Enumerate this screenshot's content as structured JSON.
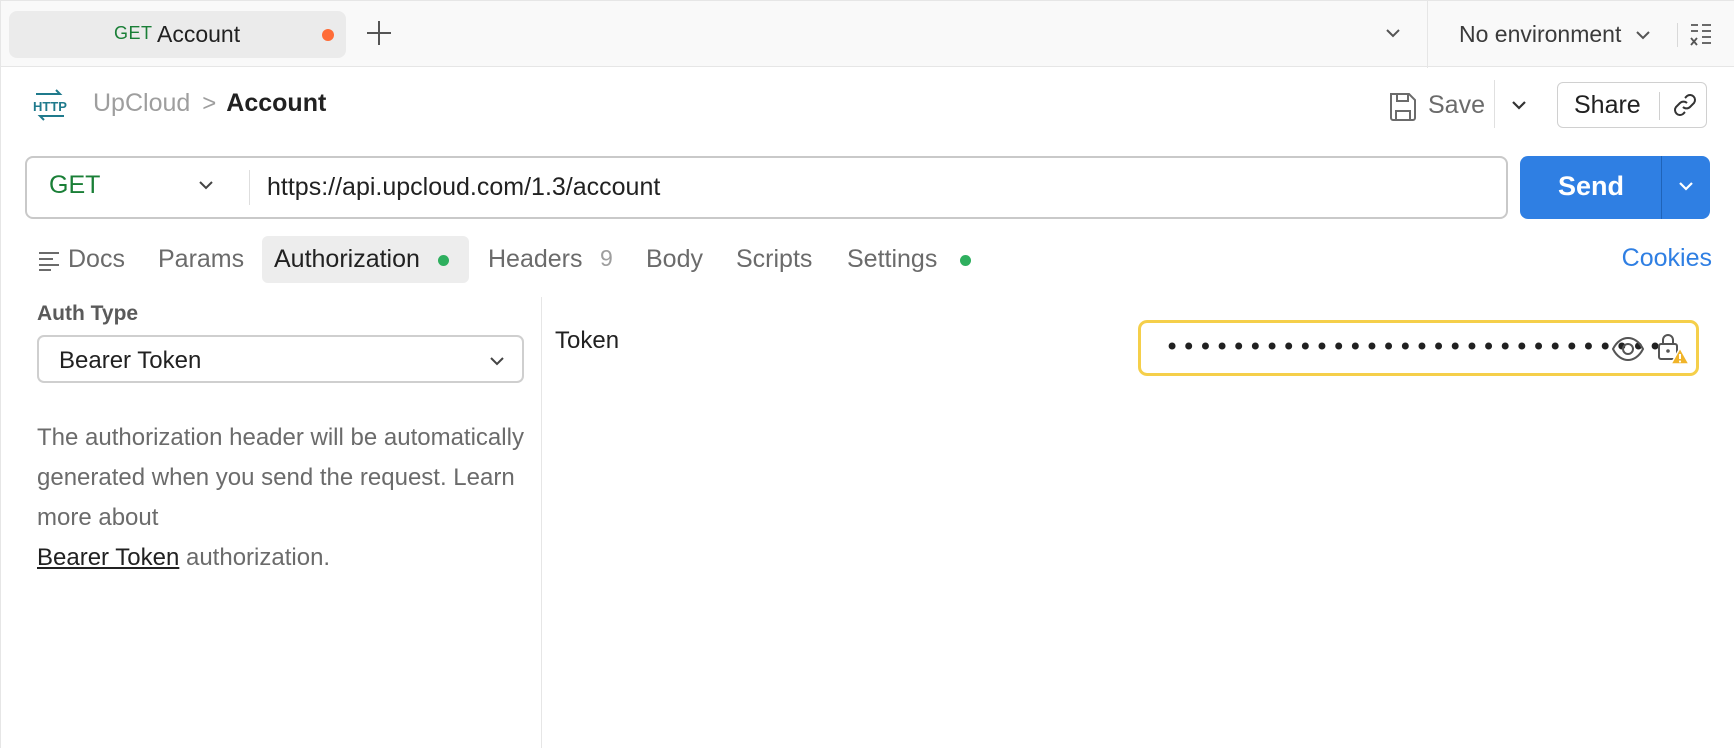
{
  "tab": {
    "method": "GET",
    "name": "Account",
    "unsaved_color": "#ff6c37"
  },
  "environment": {
    "selected": "No environment"
  },
  "header": {
    "breadcrumb_parent": "UpCloud",
    "breadcrumb_separator": ">",
    "breadcrumb_current": "Account",
    "save_label": "Save",
    "share_label": "Share"
  },
  "request": {
    "method": "GET",
    "url": "https://api.upcloud.com/1.3/account",
    "send_label": "Send"
  },
  "request_tabs": {
    "docs": "Docs",
    "params": "Params",
    "authorization": "Authorization",
    "headers": "Headers",
    "headers_count": "9",
    "body": "Body",
    "scripts": "Scripts",
    "settings": "Settings",
    "cookies": "Cookies"
  },
  "auth": {
    "type_label": "Auth Type",
    "type_value": "Bearer Token",
    "description_prefix": "The authorization header will be automatically generated when you send the request. Learn more about",
    "description_link": "Bearer Token",
    "description_suffix": "authorization.",
    "token_label": "Token",
    "token_masked": "••••••••••••••••••••••••••••••"
  },
  "colors": {
    "accent_blue": "#2f7fe3",
    "method_green": "#1a7f37",
    "status_green": "#2eaf5e",
    "warning_yellow": "#f5cf4a"
  }
}
